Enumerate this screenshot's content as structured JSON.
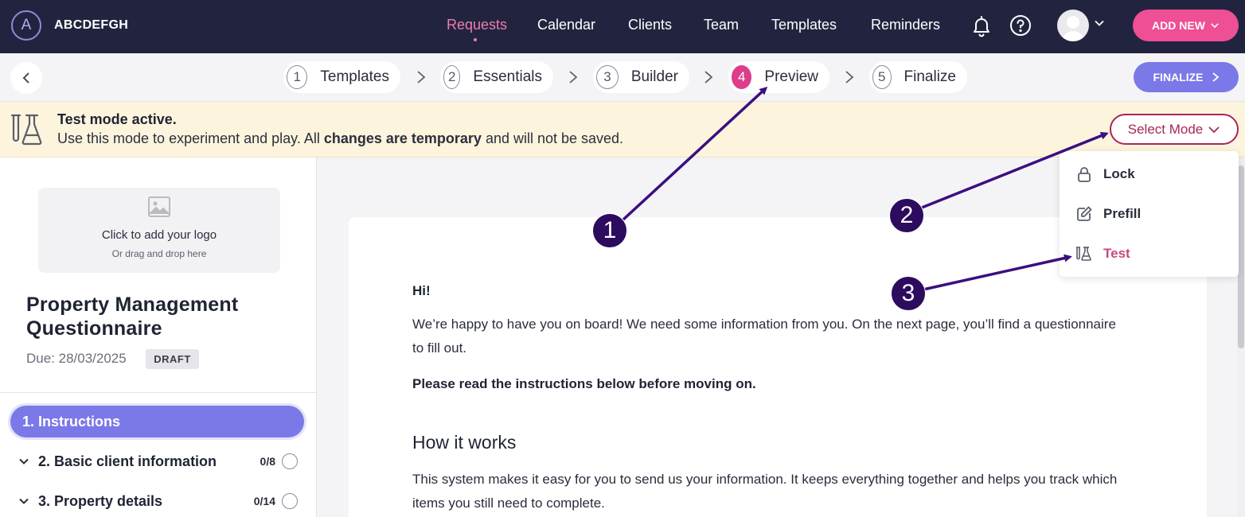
{
  "app": {
    "logo_letter": "A",
    "brand": "ABCDEFGH"
  },
  "nav": {
    "items": [
      {
        "label": "Requests",
        "active": true
      },
      {
        "label": "Calendar"
      },
      {
        "label": "Clients"
      },
      {
        "label": "Team"
      },
      {
        "label": "Templates"
      },
      {
        "label": "Reminders"
      }
    ],
    "add_new": "ADD NEW"
  },
  "steps": [
    {
      "num": "1",
      "label": "Templates"
    },
    {
      "num": "2",
      "label": "Essentials"
    },
    {
      "num": "3",
      "label": "Builder"
    },
    {
      "num": "4",
      "label": "Preview",
      "active": true
    },
    {
      "num": "5",
      "label": "Finalize"
    }
  ],
  "finalize": "FINALIZE",
  "banner": {
    "title": "Test mode active.",
    "text_pre": "Use this mode to experiment and play. All ",
    "text_bold": "changes are temporary",
    "text_post": " and will not be saved.",
    "select_mode": "Select Mode"
  },
  "mode_menu": [
    {
      "label": "Lock",
      "icon": "lock-icon"
    },
    {
      "label": "Prefill",
      "icon": "edit-icon"
    },
    {
      "label": "Test",
      "icon": "flask-icon",
      "selected": true
    }
  ],
  "sidebar": {
    "logo_title": "Click to add your logo",
    "logo_sub": "Or drag and drop here",
    "title": "Property Management Questionnaire",
    "due": "Due: 28/03/2025",
    "status": "DRAFT",
    "sections": [
      {
        "label": "1. Instructions",
        "active": true
      },
      {
        "label": "2. Basic client information",
        "count": "0/8"
      },
      {
        "label": "3. Property details",
        "count": "0/14"
      }
    ]
  },
  "content": {
    "greeting": "Hi!",
    "p1": "We’re happy to have you on board! We need some information from you. On the next page, you’ll find a questionnaire to fill out.",
    "p2": "Please read the instructions below before moving on.",
    "heading": "How it works",
    "p3": "This system makes it easy for you to send us your information. It keeps everything together and helps you track which items you still need to complete."
  },
  "annotations": [
    "1",
    "2",
    "3"
  ],
  "colors": {
    "nav_bg": "#22243f",
    "accent_pink": "#ee4f95",
    "accent_purple": "#7b78e8",
    "banner_bg": "#fdf4dd",
    "annotation": "#2d0b5e"
  }
}
